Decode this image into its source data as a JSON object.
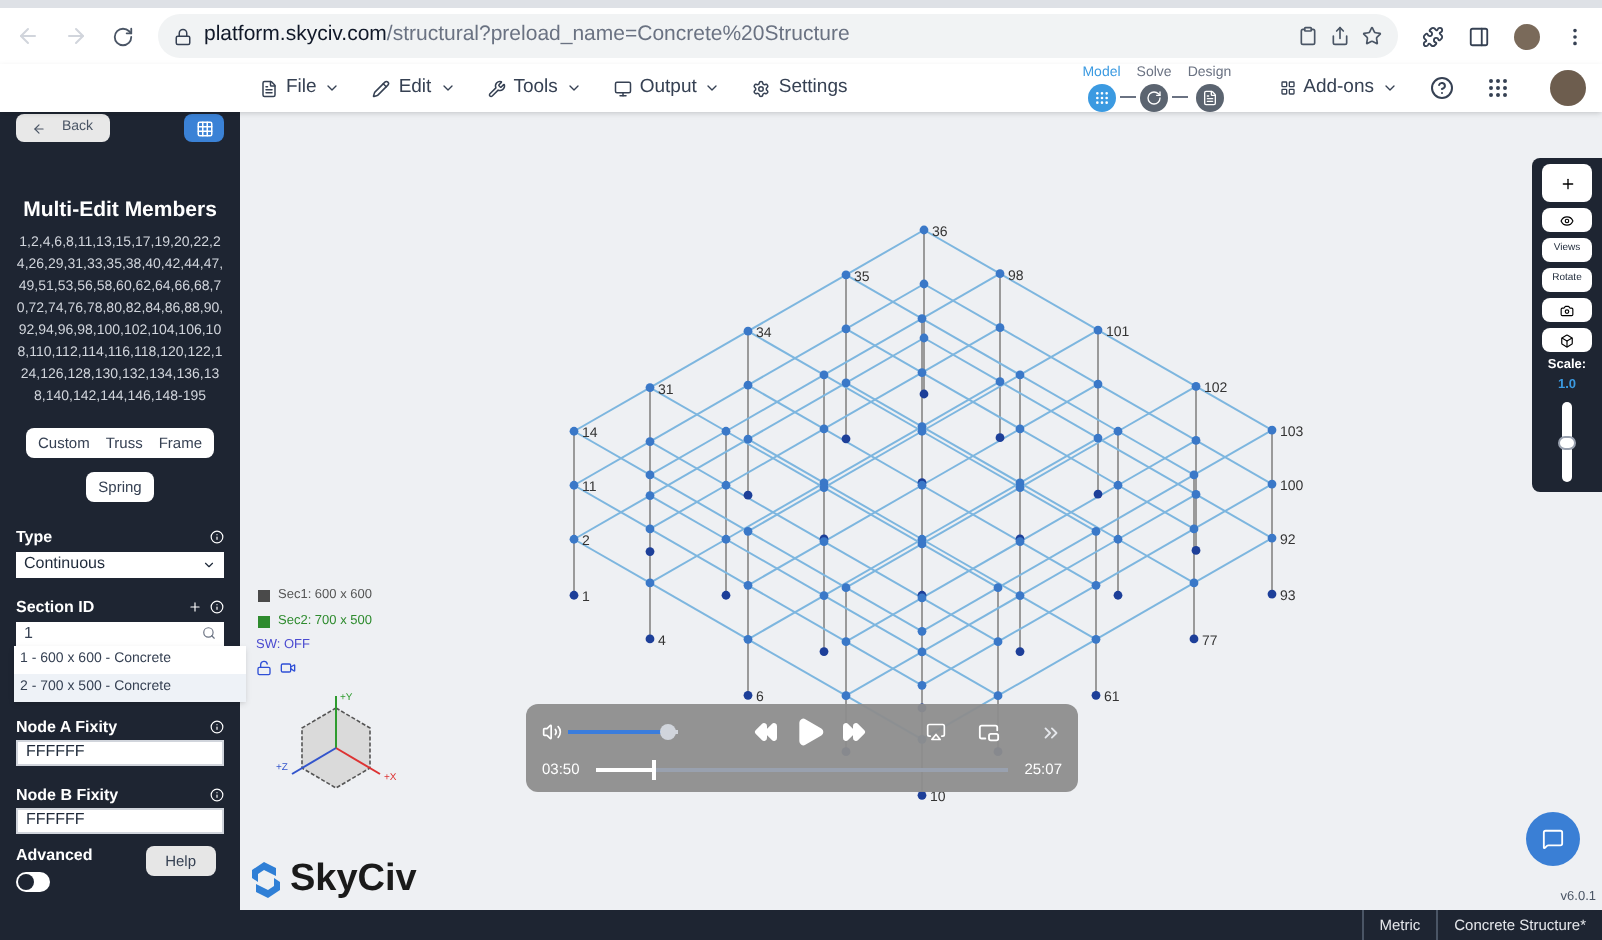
{
  "browser": {
    "host": "platform.skyciv.com",
    "path": "/structural?preload_name=Concrete%20Structure"
  },
  "menu": [
    {
      "label": "File",
      "kind": "file"
    },
    {
      "label": "Edit",
      "kind": "edit"
    },
    {
      "label": "Tools",
      "kind": "tools"
    },
    {
      "label": "Output",
      "kind": "output"
    },
    {
      "label": "Settings",
      "kind": "settings"
    }
  ],
  "steps": [
    {
      "label": "Model",
      "selected": true
    },
    {
      "label": "Solve",
      "selected": false
    },
    {
      "label": "Design",
      "selected": false
    }
  ],
  "addons": "Add-ons",
  "sidebar": {
    "back": "Back",
    "title": "Multi-Edit Members",
    "members": "1,2,4,6,8,11,13,15,17,19,20,22,24,26,29,31,33,35,38,40,42,44,47,49,51,53,56,58,60,62,64,66,68,70,72,74,76,78,80,82,84,86,88,90,92,94,96,98,100,102,104,106,108,110,112,114,116,118,120,122,124,126,128,130,132,134,136,138,140,142,144,146,148-195",
    "element_types": [
      "Custom",
      "Truss",
      "Frame"
    ],
    "spring": "Spring",
    "type": {
      "label": "Type",
      "value": "Continuous"
    },
    "section": {
      "label": "Section ID",
      "search_value": "1",
      "options": [
        {
          "label": "1 - 600 x 600 - Concrete",
          "selected": false
        },
        {
          "label": "2 - 700 x 500 - Concrete",
          "selected": true
        }
      ]
    },
    "node_a": {
      "label": "Node A Fixity",
      "value": "FFFFFF"
    },
    "node_b": {
      "label": "Node B Fixity",
      "value": "FFFFFF"
    },
    "advanced": {
      "label": "Advanced",
      "on": false
    },
    "help": "Help"
  },
  "legend": [
    {
      "label": "Sec1: 600 x 600",
      "color": "#4a4a4a"
    },
    {
      "label": "Sec2: 700 x 500",
      "color": "#2e8b2e"
    }
  ],
  "sw": "SW: OFF",
  "axes": [
    "+Y",
    "+X",
    "+Z"
  ],
  "node_labels": [
    "36",
    "98",
    "101",
    "102",
    "103",
    "100",
    "92",
    "93",
    "35",
    "34",
    "31",
    "14",
    "11",
    "2",
    "1",
    "4",
    "6",
    "77",
    "61",
    "10"
  ],
  "video": {
    "volume": {
      "level": 0.9
    },
    "progress": {
      "level": 0.14
    },
    "elapsed": "03:50",
    "total": "25:07"
  },
  "tools": [
    "Views",
    "Rotate"
  ],
  "scale": {
    "label": "Scale:",
    "value": "1.0",
    "level": 0.5
  },
  "logo": "SkyCiv",
  "version": "v6.0.1",
  "status_bar": [
    "Metric",
    "Concrete Structure*"
  ]
}
